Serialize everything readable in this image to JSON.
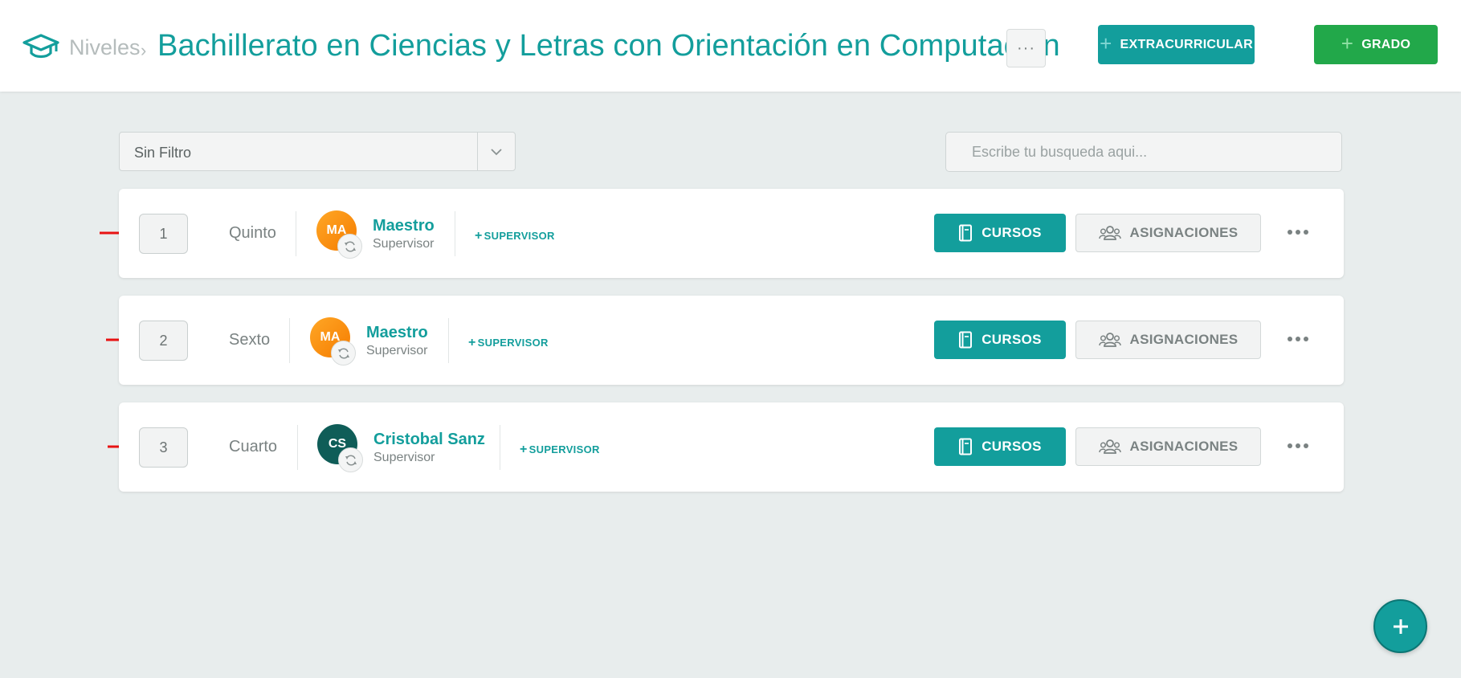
{
  "header": {
    "breadcrumb_root": "Niveles",
    "breadcrumb_sep": "›",
    "title": "Bachillerato en Ciencias y Letras con Orientación en Computación",
    "more_label": "···",
    "extracurricular_label": "EXTRACURRICULAR",
    "grado_label": "GRADO",
    "plus": "+"
  },
  "filters": {
    "select_value": "Sin Filtro",
    "search_placeholder": "Escribe tu busqueda aqui..."
  },
  "rows": [
    {
      "number": "1",
      "grade": "Quinto",
      "avatar_initials": "MA",
      "person_name": "Maestro",
      "person_role": "Supervisor",
      "add_supervisor": "SUPERVISOR",
      "cursos_label": "CURSOS",
      "asignaciones_label": "ASIGNACIONES"
    },
    {
      "number": "2",
      "grade": "Sexto",
      "avatar_initials": "MA",
      "person_name": "Maestro",
      "person_role": "Supervisor",
      "add_supervisor": "SUPERVISOR",
      "cursos_label": "CURSOS",
      "asignaciones_label": "ASIGNACIONES"
    },
    {
      "number": "3",
      "grade": "Cuarto",
      "avatar_initials": "CS",
      "person_name": "Cristobal Sanz",
      "person_role": "Supervisor",
      "add_supervisor": "SUPERVISOR",
      "cursos_label": "CURSOS",
      "asignaciones_label": "ASIGNACIONES"
    }
  ],
  "colors": {
    "teal": "#139e9c",
    "green": "#22a84a",
    "orange": "#f57c00",
    "dark_teal": "#0f5d58",
    "arrow_red": "#e81212"
  },
  "icons": {
    "logo": "graduation-cap-icon",
    "dropdown": "chevron-down-icon",
    "swap": "refresh-icon",
    "cursos": "book-icon",
    "asignaciones": "users-icon",
    "more": "more-horizontal-icon",
    "fab": "plus-icon"
  }
}
